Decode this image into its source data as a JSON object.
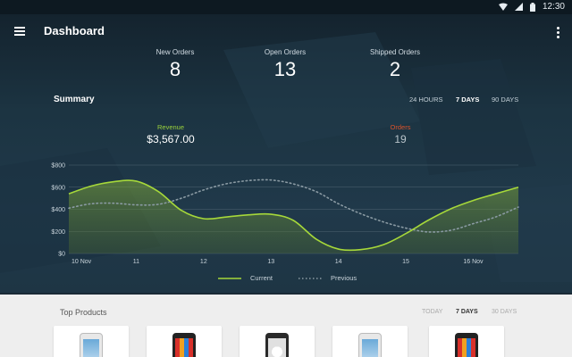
{
  "statusbar": {
    "time": "12:30",
    "icons": [
      "wifi-icon",
      "signal-icon",
      "battery-icon"
    ]
  },
  "appbar": {
    "title": "Dashboard",
    "icons": [
      "menu-icon",
      "more-vert-icon"
    ]
  },
  "stats": [
    {
      "label": "New Orders",
      "value": "8"
    },
    {
      "label": "Open Orders",
      "value": "13"
    },
    {
      "label": "Shipped Orders",
      "value": "2"
    }
  ],
  "summary": {
    "title": "Summary",
    "ranges": [
      "24 HOURS",
      "7 DAYS",
      "90 DAYS"
    ],
    "active_range": "7 DAYS",
    "revenue": {
      "label": "Revenue",
      "value": "$3,567.00",
      "color": "#9bd23c"
    },
    "orders": {
      "label": "Orders",
      "value": "19",
      "color": "#d9532c"
    }
  },
  "chart_data": {
    "type": "area",
    "title": "",
    "xlabel": "",
    "ylabel": "",
    "categories": [
      "10 Nov",
      "11",
      "12",
      "13",
      "14",
      "15",
      "16 Nov"
    ],
    "y_ticks": [
      "$800",
      "$600",
      "$400",
      "$200",
      "$0"
    ],
    "ylim": [
      0,
      800
    ],
    "grid": true,
    "legend_position": "bottom",
    "series": [
      {
        "name": "Current",
        "color": "#a6d83a",
        "style": "solid-area",
        "x": [
          0,
          0.33,
          0.67,
          1,
          1.33,
          1.67,
          2,
          2.33,
          2.67,
          3,
          3.33,
          3.67,
          4,
          4.33,
          4.67,
          5,
          5.33,
          5.67,
          6,
          6.33,
          6.67
        ],
        "values": [
          540,
          610,
          650,
          655,
          560,
          390,
          315,
          330,
          350,
          355,
          300,
          130,
          40,
          35,
          80,
          180,
          300,
          405,
          480,
          540,
          600
        ]
      },
      {
        "name": "Previous",
        "color": "#8a9aa3",
        "style": "dotted",
        "x": [
          0,
          0.33,
          0.67,
          1,
          1.33,
          1.67,
          2,
          2.33,
          2.67,
          3,
          3.33,
          3.67,
          4,
          4.33,
          4.67,
          5,
          5.33,
          5.67,
          6,
          6.33,
          6.67
        ],
        "values": [
          410,
          450,
          455,
          440,
          445,
          500,
          575,
          630,
          660,
          665,
          630,
          560,
          450,
          360,
          285,
          230,
          195,
          210,
          270,
          330,
          420
        ]
      }
    ]
  },
  "top_products": {
    "title": "Top Products",
    "ranges": [
      "TODAY",
      "7 DAYS",
      "30 DAYS"
    ],
    "active_range": "7 DAYS",
    "items": [
      {
        "name": "product-phone-white",
        "color": "#e8e8e8"
      },
      {
        "name": "product-phone-red",
        "color": "#222222"
      },
      {
        "name": "product-phone-black",
        "color": "#2a2a2a"
      },
      {
        "name": "product-phone-white",
        "color": "#e8e8e8"
      },
      {
        "name": "product-phone-red",
        "color": "#222222"
      }
    ]
  }
}
